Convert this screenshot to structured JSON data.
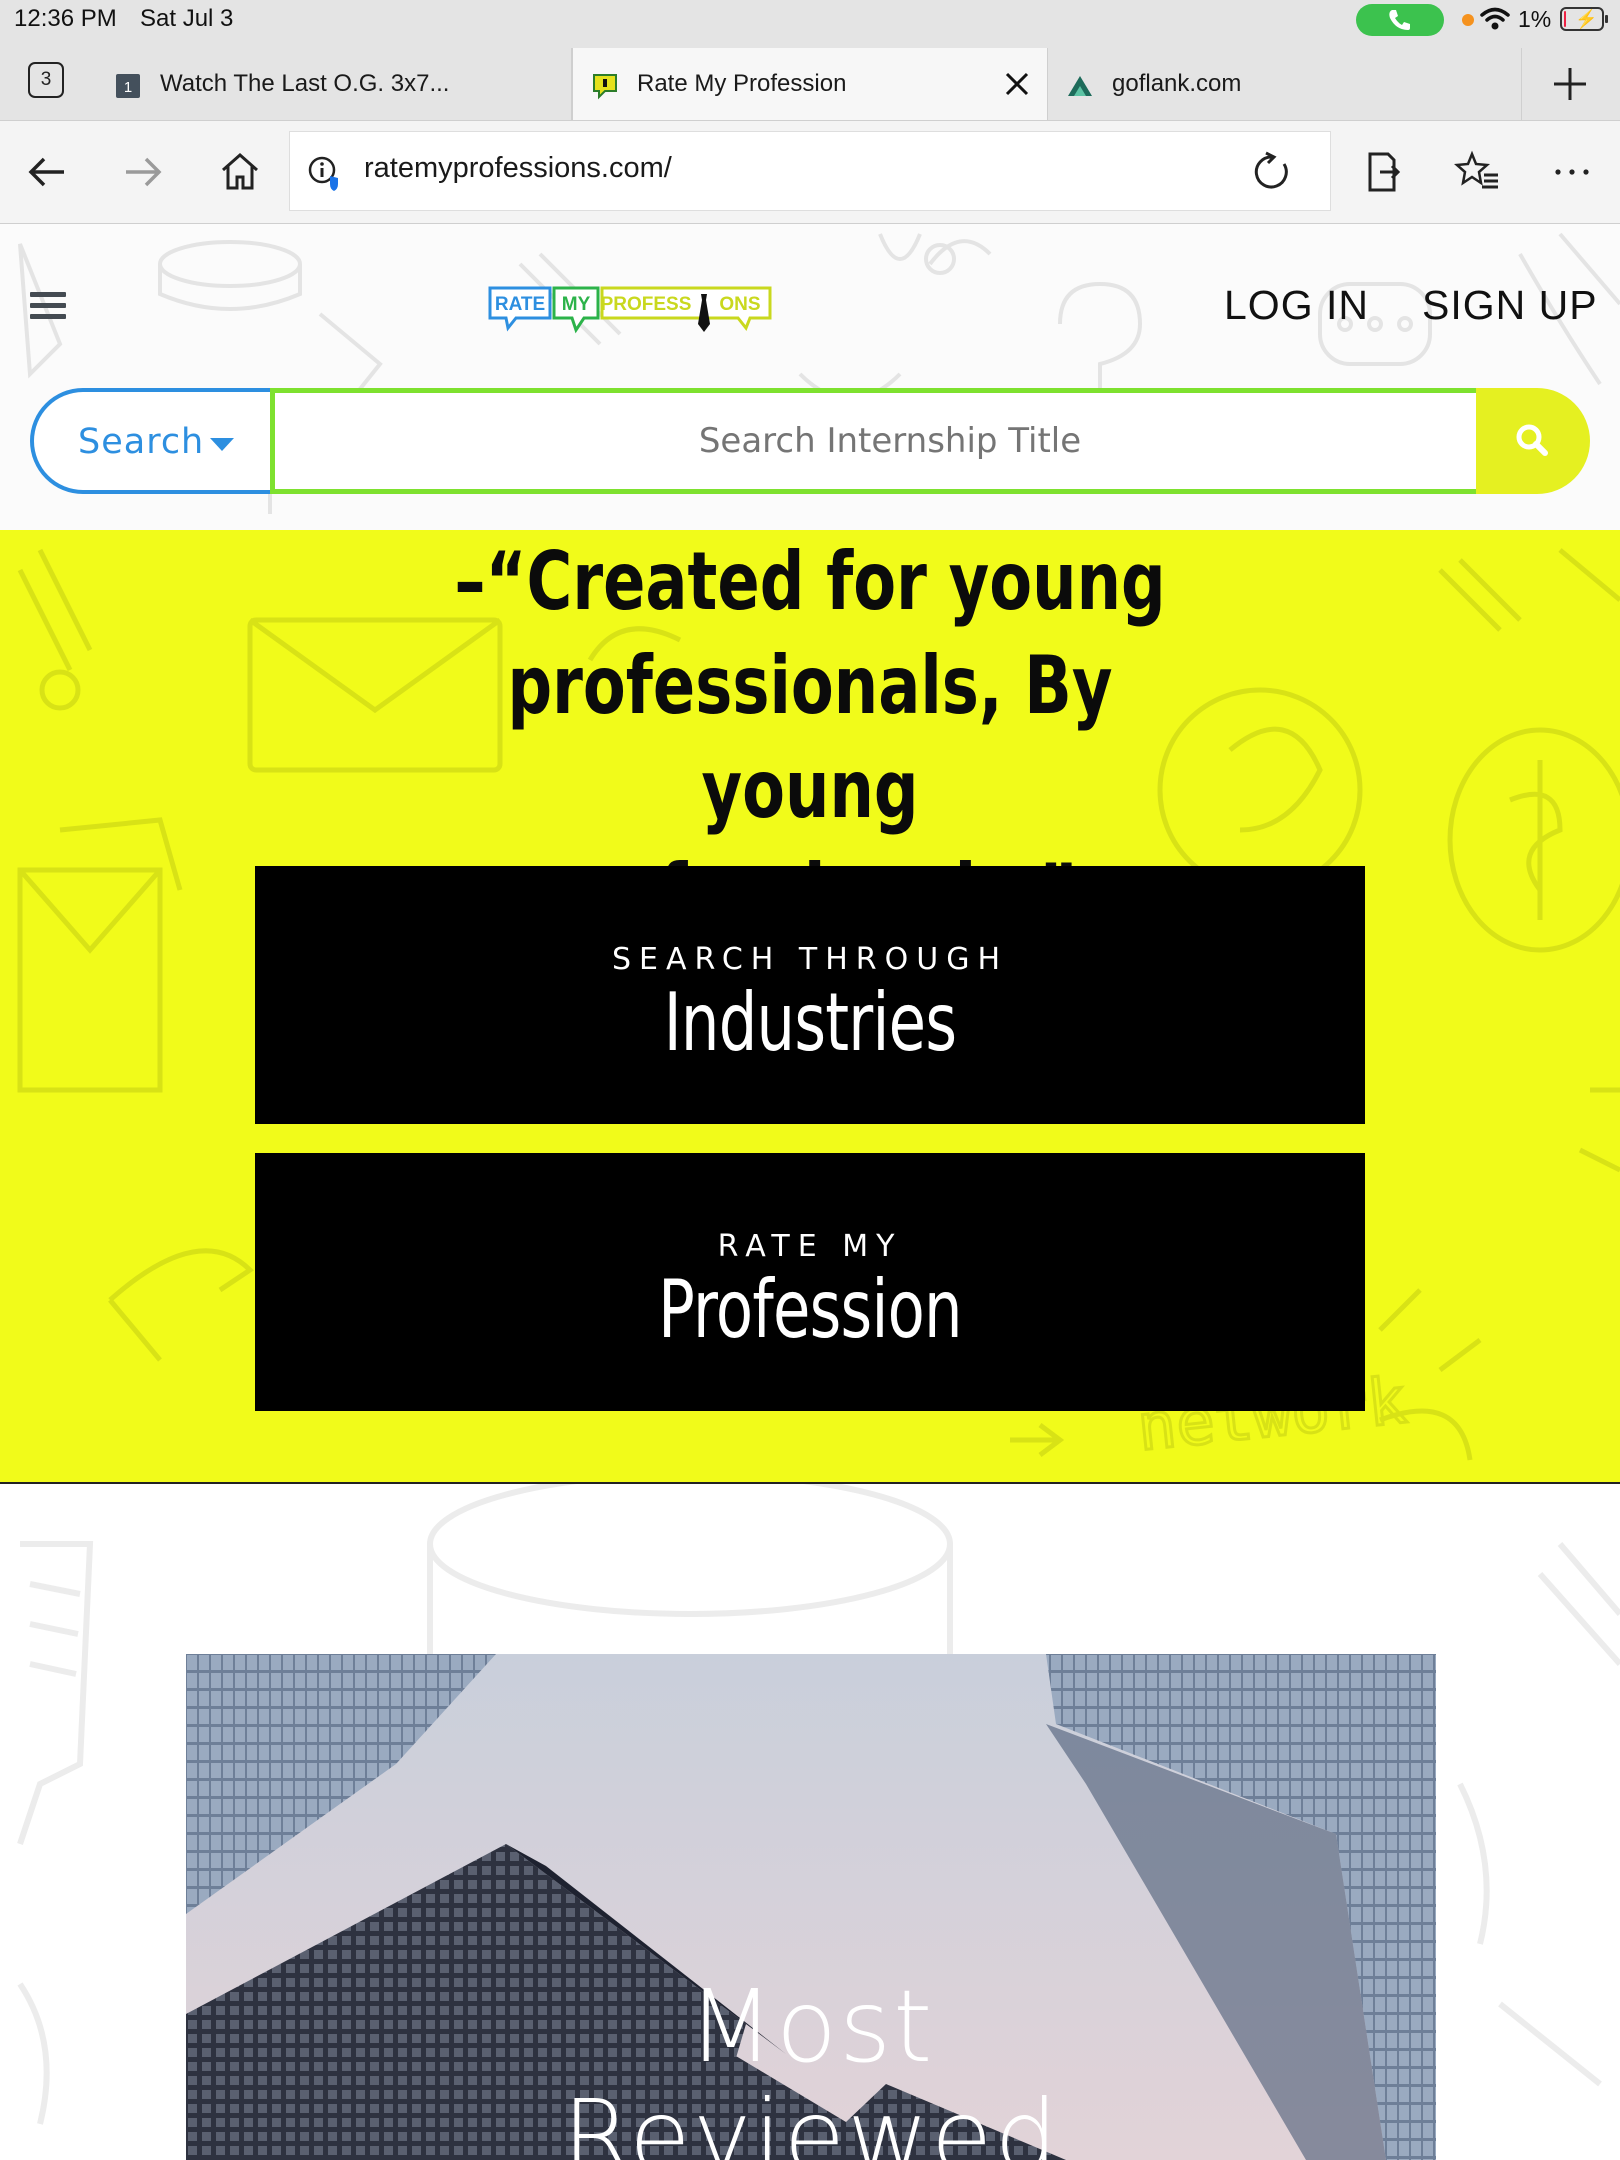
{
  "status_bar": {
    "time": "12:36 PM",
    "date": "Sat Jul 3",
    "battery_percent": "1%",
    "battery_level": 0.01,
    "call_active_color": "#3cc24e"
  },
  "browser": {
    "tab_count": "3",
    "tabs": [
      {
        "title": "Watch The Last O.G. 3x7...",
        "favicon": "video-favicon",
        "badge": "1"
      },
      {
        "title": "Rate My Profession",
        "favicon": "rmp-favicon",
        "active": true
      },
      {
        "title": "goflank.com",
        "favicon": "triangle-favicon"
      }
    ],
    "url": "ratemyprofessions.com/"
  },
  "site": {
    "logo": {
      "word1": "RATE",
      "word2": "MY",
      "word3": "PROFESS",
      "word4": "ONS"
    },
    "login_label": "LOG IN",
    "signup_label": "SIGN UP",
    "search": {
      "dropdown_label": "Search",
      "placeholder": "Search Internship Title"
    },
    "hero": {
      "quote_line1": "–“Created for young",
      "quote_line2": "professionals, By young",
      "quote_line3": "professionals.”",
      "cta1_small": "SEARCH THROUGH",
      "cta1_big": "Industries",
      "cta2_small": "RATE MY",
      "cta2_big": "Profession",
      "doodle_word": "network"
    },
    "section2": {
      "title_line1": "Most",
      "title_line2": "Reviewed"
    },
    "colors": {
      "accent_yellow": "#f1fb1a",
      "search_blue": "#2d8fe0",
      "search_green": "#7ee12f",
      "button_black": "#000000"
    }
  }
}
